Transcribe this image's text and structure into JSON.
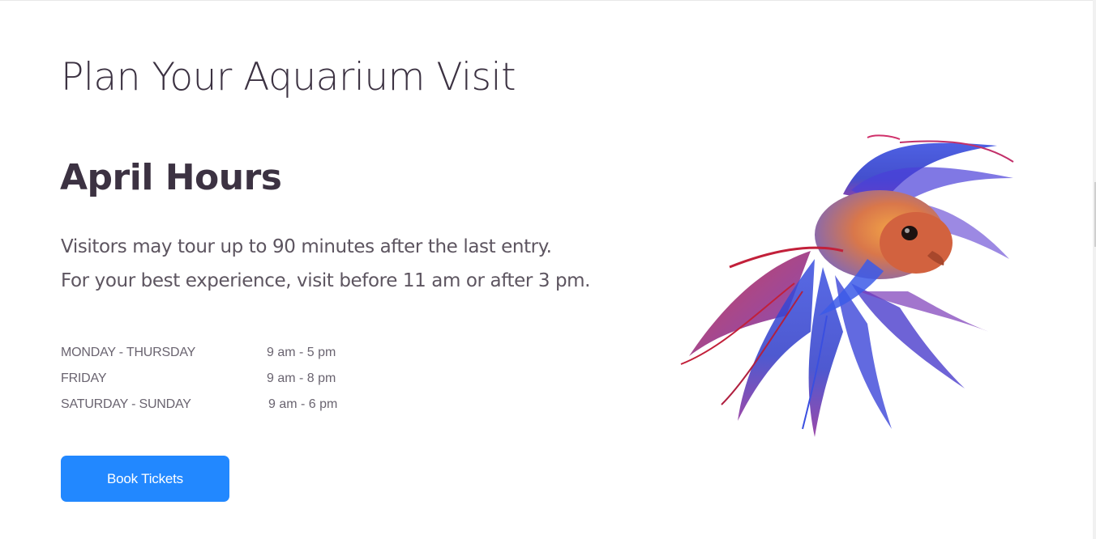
{
  "page": {
    "title": "Plan Your Aquarium Visit"
  },
  "hours_section": {
    "heading": "April Hours",
    "intro_lines": [
      "Visitors may tour up to 90 minutes after the last entry.",
      "For your best experience, visit before 11 am or after 3 pm."
    ],
    "schedule": [
      {
        "days": "MONDAY - THURSDAY",
        "time": "9 am - 5 pm"
      },
      {
        "days": "FRIDAY",
        "time": "9 am - 8 pm"
      },
      {
        "days": "SATURDAY - SUNDAY",
        "time": "9 am - 6 pm"
      }
    ]
  },
  "cta": {
    "book_label": "Book Tickets"
  },
  "image": {
    "subject": "betta-fish-icon"
  },
  "colors": {
    "text_dark": "#3c3242",
    "text_muted": "#6a6470",
    "button_blue": "#2288ff",
    "background": "#ffffff"
  }
}
